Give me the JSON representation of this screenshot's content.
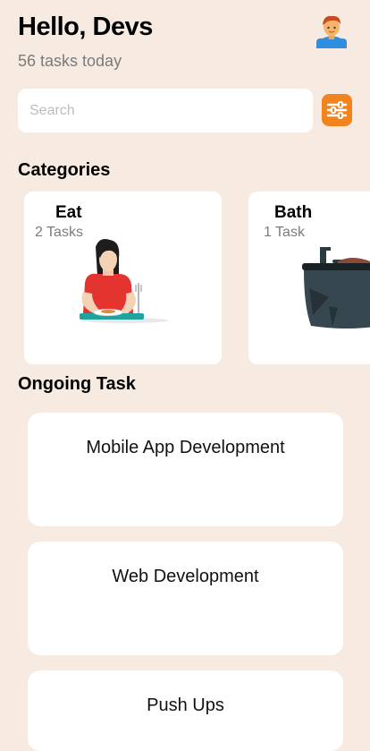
{
  "header": {
    "title": "Hello, Devs",
    "subtitle": "56 tasks today",
    "avatar_icon": "user-avatar-icon"
  },
  "search": {
    "placeholder": "Search",
    "value": ""
  },
  "filter": {
    "icon": "sliders-icon",
    "color": "#F2841F"
  },
  "categories": {
    "title": "Categories",
    "items": [
      {
        "name": "Eat",
        "count": "2 Tasks",
        "illustration": "woman-eating-illustration"
      },
      {
        "name": "Bath",
        "count": "1 Task",
        "illustration": "bathtub-illustration"
      }
    ]
  },
  "ongoing": {
    "title": "Ongoing Task",
    "tasks": [
      {
        "label": "Mobile App Development"
      },
      {
        "label": "Web Development"
      },
      {
        "label": "Push Ups"
      }
    ]
  },
  "colors": {
    "background": "#F7EBE1",
    "card": "#FFFFFF",
    "accent": "#F2841F",
    "muted_text": "#7B7B7B"
  }
}
